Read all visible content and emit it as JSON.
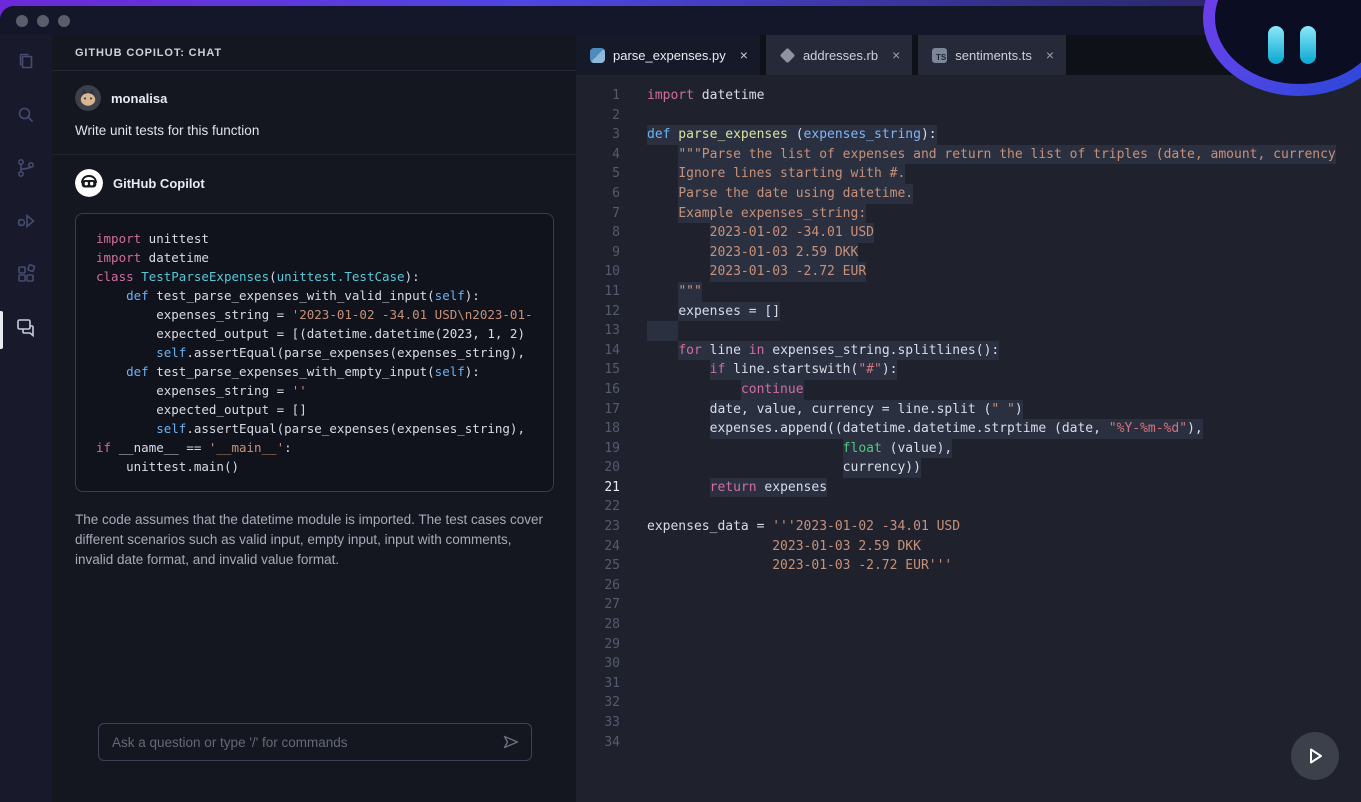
{
  "window": {
    "controls": [
      "close",
      "minimize",
      "maximize"
    ]
  },
  "activity_bar": {
    "items": [
      {
        "name": "explorer",
        "icon": "files-icon",
        "active": false
      },
      {
        "name": "search",
        "icon": "search-icon",
        "active": false
      },
      {
        "name": "source-control",
        "icon": "git-branch-icon",
        "active": false
      },
      {
        "name": "run-debug",
        "icon": "debug-icon",
        "active": false
      },
      {
        "name": "extensions",
        "icon": "extensions-icon",
        "active": false
      },
      {
        "name": "copilot-chat",
        "icon": "chat-icon",
        "active": true
      }
    ]
  },
  "chat": {
    "header_title": "GITHUB COPILOT: CHAT",
    "user": {
      "name": "monalisa",
      "message": "Write unit tests for this function"
    },
    "assistant": {
      "name": "GitHub Copilot",
      "code": [
        {
          "s": [
            [
              "kw",
              "import"
            ],
            [
              "pl",
              " unittest"
            ]
          ]
        },
        {
          "s": [
            [
              "kw",
              "import"
            ],
            [
              "pl",
              " datetime"
            ]
          ]
        },
        {
          "s": []
        },
        {
          "s": [
            [
              "kw",
              "class"
            ],
            [
              "cls",
              " TestParseExpenses"
            ],
            [
              "pl",
              "("
            ],
            [
              "cls",
              "unittest.TestCase"
            ],
            [
              "pl",
              "):"
            ]
          ]
        },
        {
          "s": [
            [
              "ind",
              "    "
            ],
            [
              "def",
              "def"
            ],
            [
              "pl",
              " test_parse_expenses_with_valid_input("
            ],
            [
              "def",
              "self"
            ],
            [
              "pl",
              "):"
            ]
          ]
        },
        {
          "s": [
            [
              "ind",
              "        "
            ],
            [
              "pl",
              "expenses_string = "
            ],
            [
              "str",
              "'2023-01-02 -34.01 USD\\n2023-01-"
            ]
          ]
        },
        {
          "s": [
            [
              "ind",
              "        "
            ],
            [
              "pl",
              "expected_output = [(datetime.datetime(2023, 1, 2)"
            ]
          ]
        },
        {
          "s": [
            [
              "ind",
              "        "
            ],
            [
              "def",
              "self"
            ],
            [
              "pl",
              ".assertEqual(parse_expenses(expenses_string),"
            ]
          ]
        },
        {
          "s": []
        },
        {
          "s": [
            [
              "ind",
              "    "
            ],
            [
              "def",
              "def"
            ],
            [
              "pl",
              " test_parse_expenses_with_empty_input("
            ],
            [
              "def",
              "self"
            ],
            [
              "pl",
              "):"
            ]
          ]
        },
        {
          "s": [
            [
              "ind",
              "        "
            ],
            [
              "pl",
              "expenses_string = "
            ],
            [
              "str",
              "''"
            ]
          ]
        },
        {
          "s": [
            [
              "ind",
              "        "
            ],
            [
              "pl",
              "expected_output = []"
            ]
          ]
        },
        {
          "s": [
            [
              "ind",
              "        "
            ],
            [
              "def",
              "self"
            ],
            [
              "pl",
              ".assertEqual(parse_expenses(expenses_string),"
            ]
          ]
        },
        {
          "s": []
        },
        {
          "s": [
            [
              "kw",
              "if"
            ],
            [
              "pl",
              " __name__ == "
            ],
            [
              "str",
              "'__main__'"
            ],
            [
              "pl",
              ":"
            ]
          ]
        },
        {
          "s": [
            [
              "ind",
              "    "
            ],
            [
              "pl",
              "unittest.main()"
            ]
          ]
        }
      ],
      "explanation": "The code assumes that the datetime module is imported. The test cases cover different scenarios such as valid input, empty input, input with comments, invalid date format, and invalid value format."
    },
    "input": {
      "placeholder": "Ask a question or type '/' for commands",
      "send_icon": "send-icon"
    }
  },
  "editor": {
    "close_glyph": "×",
    "tabs": [
      {
        "label": "parse_expenses.py",
        "icon": "python",
        "icon_text": "",
        "active": true
      },
      {
        "label": "addresses.rb",
        "icon": "ruby",
        "icon_text": "",
        "active": false
      },
      {
        "label": "sentiments.ts",
        "icon": "ts",
        "icon_text": "TS",
        "active": false
      }
    ],
    "lines": [
      {
        "n": 1,
        "s": [
          [
            "kw",
            "import"
          ],
          [
            "pl",
            " datetime"
          ]
        ]
      },
      {
        "n": 2
      },
      {
        "n": 3,
        "sel": true,
        "s": [
          [
            "def",
            "def"
          ],
          [
            "fn",
            " parse_expenses"
          ],
          [
            "pl",
            " ("
          ],
          [
            "param",
            "expenses_string"
          ],
          [
            "pl",
            "):"
          ]
        ]
      },
      {
        "n": 4,
        "sel": true,
        "full": true,
        "s": [
          [
            "ind",
            "    "
          ],
          [
            "str",
            "\"\"\"Parse the list of expenses and return the list of triples (date, amount, currency"
          ]
        ]
      },
      {
        "n": 5,
        "sel": true,
        "s": [
          [
            "ind",
            "    "
          ],
          [
            "str",
            "Ignore lines starting with #."
          ]
        ]
      },
      {
        "n": 6,
        "sel": true,
        "s": [
          [
            "ind",
            "    "
          ],
          [
            "str",
            "Parse the date using datetime."
          ]
        ]
      },
      {
        "n": 7,
        "sel": true,
        "s": [
          [
            "ind",
            "    "
          ],
          [
            "str",
            "Example expenses_string:"
          ]
        ]
      },
      {
        "n": 8,
        "sel": true,
        "s": [
          [
            "ind",
            "        "
          ],
          [
            "str",
            "2023-01-02 -34.01 USD"
          ]
        ]
      },
      {
        "n": 9,
        "sel": true,
        "s": [
          [
            "ind",
            "        "
          ],
          [
            "str",
            "2023-01-03 2.59 DKK"
          ]
        ]
      },
      {
        "n": 10,
        "sel": true,
        "s": [
          [
            "ind",
            "        "
          ],
          [
            "str",
            "2023-01-03 -2.72 EUR"
          ]
        ]
      },
      {
        "n": 11,
        "sel": true,
        "s": [
          [
            "ind",
            "    "
          ],
          [
            "str",
            "\"\"\""
          ]
        ]
      },
      {
        "n": 12,
        "sel": true,
        "s": [
          [
            "ind",
            "    "
          ],
          [
            "pl",
            "expenses = []"
          ]
        ]
      },
      {
        "n": 13,
        "sel": true,
        "s": []
      },
      {
        "n": 14,
        "sel": true,
        "s": [
          [
            "ind",
            "    "
          ],
          [
            "kw",
            "for"
          ],
          [
            "pl",
            " line "
          ],
          [
            "kw",
            "in"
          ],
          [
            "pl",
            " expenses_string.splitlines():"
          ]
        ]
      },
      {
        "n": 15,
        "sel": true,
        "s": [
          [
            "ind",
            "        "
          ],
          [
            "kw",
            "if"
          ],
          [
            "pl",
            " line.startswith("
          ],
          [
            "str2",
            "\"#\""
          ],
          [
            "pl",
            "):"
          ]
        ]
      },
      {
        "n": 16,
        "sel": true,
        "s": [
          [
            "ind",
            "            "
          ],
          [
            "kw",
            "continue"
          ]
        ]
      },
      {
        "n": 17,
        "sel": true,
        "s": [
          [
            "ind",
            "        "
          ],
          [
            "pl",
            "date, value, currency = line.split ("
          ],
          [
            "str",
            "\" \""
          ],
          [
            "pl",
            ")"
          ]
        ]
      },
      {
        "n": 18,
        "sel": true,
        "s": [
          [
            "ind",
            "        "
          ],
          [
            "pl",
            "expenses.append((datetime.datetime.strptime (date, "
          ],
          [
            "str2",
            "\"%Y-%m-%d\""
          ],
          [
            "pl",
            "),"
          ]
        ]
      },
      {
        "n": 19,
        "sel": true,
        "s": [
          [
            "ind",
            "                         "
          ],
          [
            "grn",
            "float"
          ],
          [
            "pl",
            " (value),"
          ]
        ]
      },
      {
        "n": 20,
        "sel": true,
        "s": [
          [
            "ind",
            "                         "
          ],
          [
            "pl",
            "currency))"
          ]
        ]
      },
      {
        "n": 21,
        "sel": true,
        "cur": true,
        "s": [
          [
            "ind",
            "        "
          ],
          [
            "kw",
            "return"
          ],
          [
            "pl",
            " expenses"
          ]
        ]
      },
      {
        "n": 22
      },
      {
        "n": 23,
        "s": [
          [
            "pl",
            "expenses_data = "
          ],
          [
            "str",
            "'''2023-01-02 -34.01 USD"
          ]
        ]
      },
      {
        "n": 24,
        "s": [
          [
            "ind",
            "                "
          ],
          [
            "str",
            "2023-01-03 2.59 DKK"
          ]
        ]
      },
      {
        "n": 25,
        "s": [
          [
            "ind",
            "                "
          ],
          [
            "str",
            "2023-01-03 -2.72 EUR'''"
          ]
        ]
      },
      {
        "n": 26
      },
      {
        "n": 27
      },
      {
        "n": 28
      },
      {
        "n": 29
      },
      {
        "n": 30
      },
      {
        "n": 31
      },
      {
        "n": 32
      },
      {
        "n": 33
      },
      {
        "n": 34
      }
    ]
  }
}
